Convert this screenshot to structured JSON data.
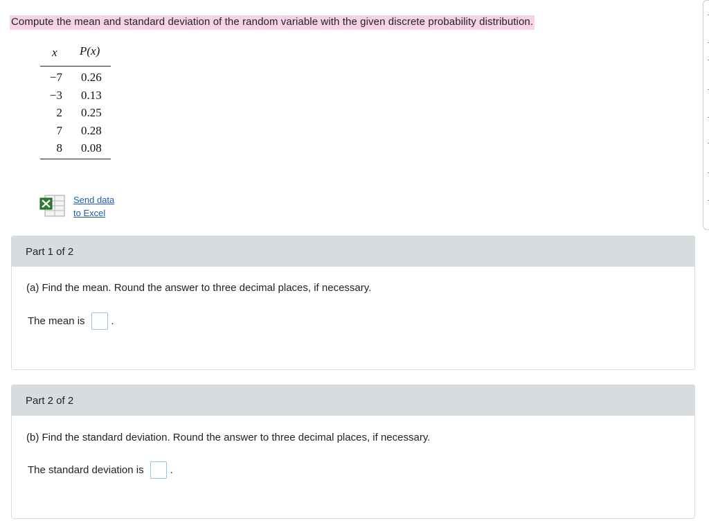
{
  "question": {
    "prompt": "Compute the mean and standard deviation of the random variable with the given discrete probability distribution."
  },
  "table": {
    "col_x": "x",
    "col_p": "P(x)",
    "rows": [
      {
        "x": "−7",
        "p": "0.26"
      },
      {
        "x": "−3",
        "p": "0.13"
      },
      {
        "x": "2",
        "p": "0.25"
      },
      {
        "x": "7",
        "p": "0.28"
      },
      {
        "x": "8",
        "p": "0.08"
      }
    ]
  },
  "excel": {
    "icon": "excel-spreadsheet-icon",
    "link_line1": "Send data",
    "link_line2": "to Excel"
  },
  "parts": [
    {
      "header": "Part 1 of 2",
      "instruction": "(a) Find the mean. Round the answer to three decimal places, if necessary.",
      "answer_label": "The mean is",
      "answer_value": "",
      "suffix": "."
    },
    {
      "header": "Part 2 of 2",
      "instruction": "(b) Find the standard deviation. Round the answer to three decimal places, if necessary.",
      "answer_label": "The standard deviation is",
      "answer_value": "",
      "suffix": "."
    }
  ],
  "colors": {
    "highlight": "#f6d3e7",
    "part_header_bg": "#d7dcdf",
    "link": "#1a5cb4",
    "input_border": "#8fc5e3"
  }
}
